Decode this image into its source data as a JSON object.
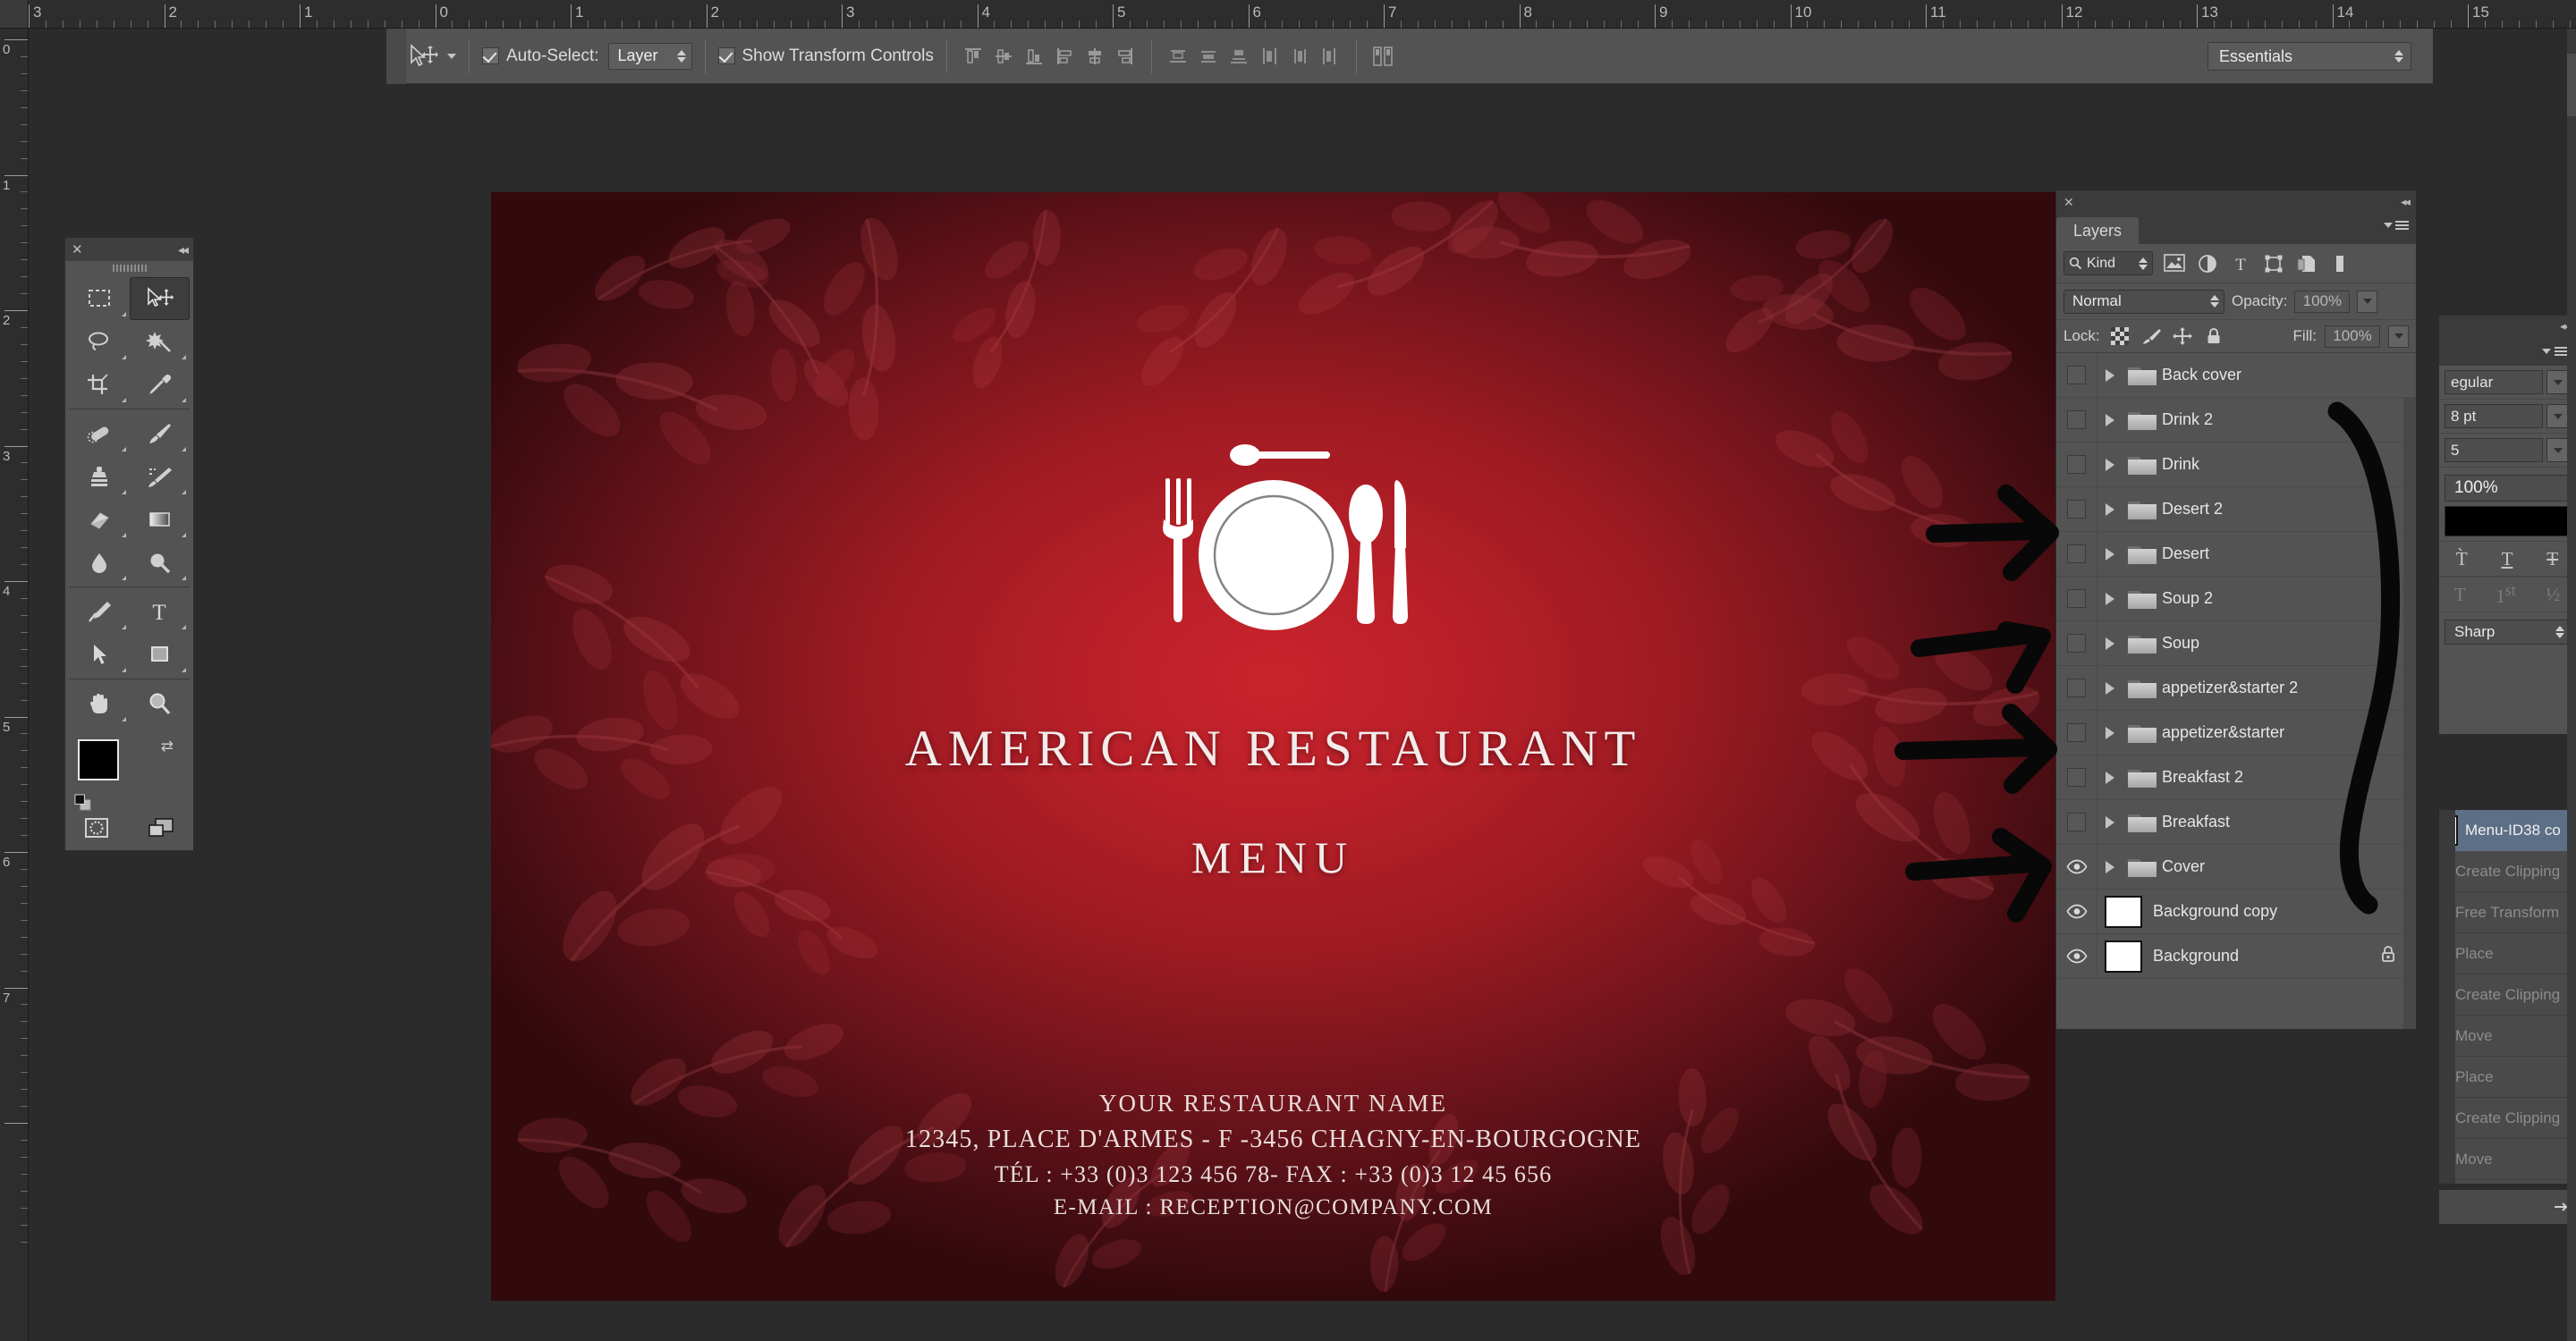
{
  "app": {
    "workspace": "Essentials",
    "active_tool": "move-tool"
  },
  "rulers": {
    "top_labels": [
      "3",
      "2",
      "1",
      "0",
      "1",
      "2",
      "3",
      "4",
      "5",
      "6",
      "7",
      "8",
      "9",
      "10",
      "11",
      "12",
      "13",
      "14",
      "15"
    ],
    "left_labels": [
      "0",
      "1",
      "2",
      "3",
      "4",
      "5",
      "6",
      "7"
    ],
    "unit": "inches"
  },
  "options_bar": {
    "auto_select_label": "Auto-Select:",
    "auto_select_checked": true,
    "auto_select_value": "Layer",
    "show_transform_label": "Show Transform Controls",
    "show_transform_checked": true,
    "align_buttons": [
      "align-top-edges",
      "align-vertical-centers",
      "align-bottom-edges",
      "align-left-edges",
      "align-horizontal-centers",
      "align-right-edges"
    ],
    "distribute_buttons": [
      "distribute-top-edges",
      "distribute-vertical-centers",
      "distribute-bottom-edges",
      "distribute-left-edges",
      "distribute-horizontal-centers",
      "distribute-right-edges"
    ],
    "auto_align_button": "auto-align-layers"
  },
  "toolbar": {
    "tools": [
      "rectangular-marquee-tool",
      "move-tool",
      "lasso-tool",
      "magic-wand-tool",
      "crop-tool",
      "eyedropper-tool",
      "spot-healing-brush-tool",
      "brush-tool",
      "clone-stamp-tool",
      "history-brush-tool",
      "eraser-tool",
      "gradient-tool",
      "blur-tool",
      "dodge-tool",
      "pen-tool",
      "horizontal-type-tool",
      "path-selection-tool",
      "rectangle-tool",
      "hand-tool",
      "zoom-tool"
    ],
    "foreground_color": "#000000",
    "background_color": "#ffffff"
  },
  "document": {
    "title_main": "AMERICAN RESTAURANT",
    "title_sub": "MENU",
    "contact": {
      "name": "YOUR RESTAURANT NAME",
      "address": "12345, PLACE D'ARMES - F -3456  CHAGNY-EN-BOURGOGNE",
      "phone": "TÉL : +33 (0)3 123 456 78- FAX : +33 (0)3 12 45 656",
      "email": "E-MAIL : RECEPTION@COMPANY.COM"
    },
    "accent_color": "#b81f28",
    "logo": "place-setting-icon"
  },
  "layers_panel": {
    "tab_label": "Layers",
    "filter_kind": "Kind",
    "filter_icons": [
      "pixel-layers-filter",
      "adjustment-layers-filter",
      "type-layers-filter",
      "shape-layers-filter",
      "smart-object-filter"
    ],
    "blend_mode": "Normal",
    "opacity_label": "Opacity:",
    "opacity_value": "100%",
    "lock_label": "Lock:",
    "lock_icons": [
      "lock-transparent-pixels",
      "lock-image-pixels",
      "lock-position",
      "lock-all"
    ],
    "fill_label": "Fill:",
    "fill_value": "100%",
    "layers": [
      {
        "name": "Back cover",
        "type": "group",
        "visible": false,
        "locked": false
      },
      {
        "name": "Drink 2",
        "type": "group",
        "visible": false,
        "locked": false
      },
      {
        "name": "Drink",
        "type": "group",
        "visible": false,
        "locked": false
      },
      {
        "name": "Desert 2",
        "type": "group",
        "visible": false,
        "locked": false
      },
      {
        "name": "Desert",
        "type": "group",
        "visible": false,
        "locked": false
      },
      {
        "name": "Soup 2",
        "type": "group",
        "visible": false,
        "locked": false
      },
      {
        "name": "Soup",
        "type": "group",
        "visible": false,
        "locked": false
      },
      {
        "name": "appetizer&starter 2",
        "type": "group",
        "visible": false,
        "locked": false
      },
      {
        "name": "appetizer&starter",
        "type": "group",
        "visible": false,
        "locked": false
      },
      {
        "name": "Breakfast 2",
        "type": "group",
        "visible": false,
        "locked": false
      },
      {
        "name": "Breakfast",
        "type": "group",
        "visible": false,
        "locked": false
      },
      {
        "name": "Cover",
        "type": "group",
        "visible": true,
        "locked": false
      },
      {
        "name": "Background copy",
        "type": "raster",
        "visible": true,
        "locked": false
      },
      {
        "name": "Background",
        "type": "raster",
        "visible": true,
        "locked": true
      }
    ]
  },
  "character_panel": {
    "font_style": "egular",
    "font_size": "8 pt",
    "leading": "5",
    "scale": "100%",
    "color": "#000000",
    "style_icons": [
      "all-caps",
      "small-caps",
      "underline",
      "strikethrough"
    ],
    "ot_icons": [
      "standard-ligatures",
      "ordinals",
      "fractions"
    ],
    "antialias": "Sharp"
  },
  "history_panel": {
    "selected": "Menu-ID38 co",
    "items": [
      "Create Clipping",
      "Free Transform",
      "Place",
      "Create Clipping",
      "Move",
      "Place",
      "Create Clipping",
      "Move"
    ]
  },
  "annotations": {
    "arrow_count": 4,
    "bracket": "hand-drawn-bracket",
    "color": "#000000"
  }
}
